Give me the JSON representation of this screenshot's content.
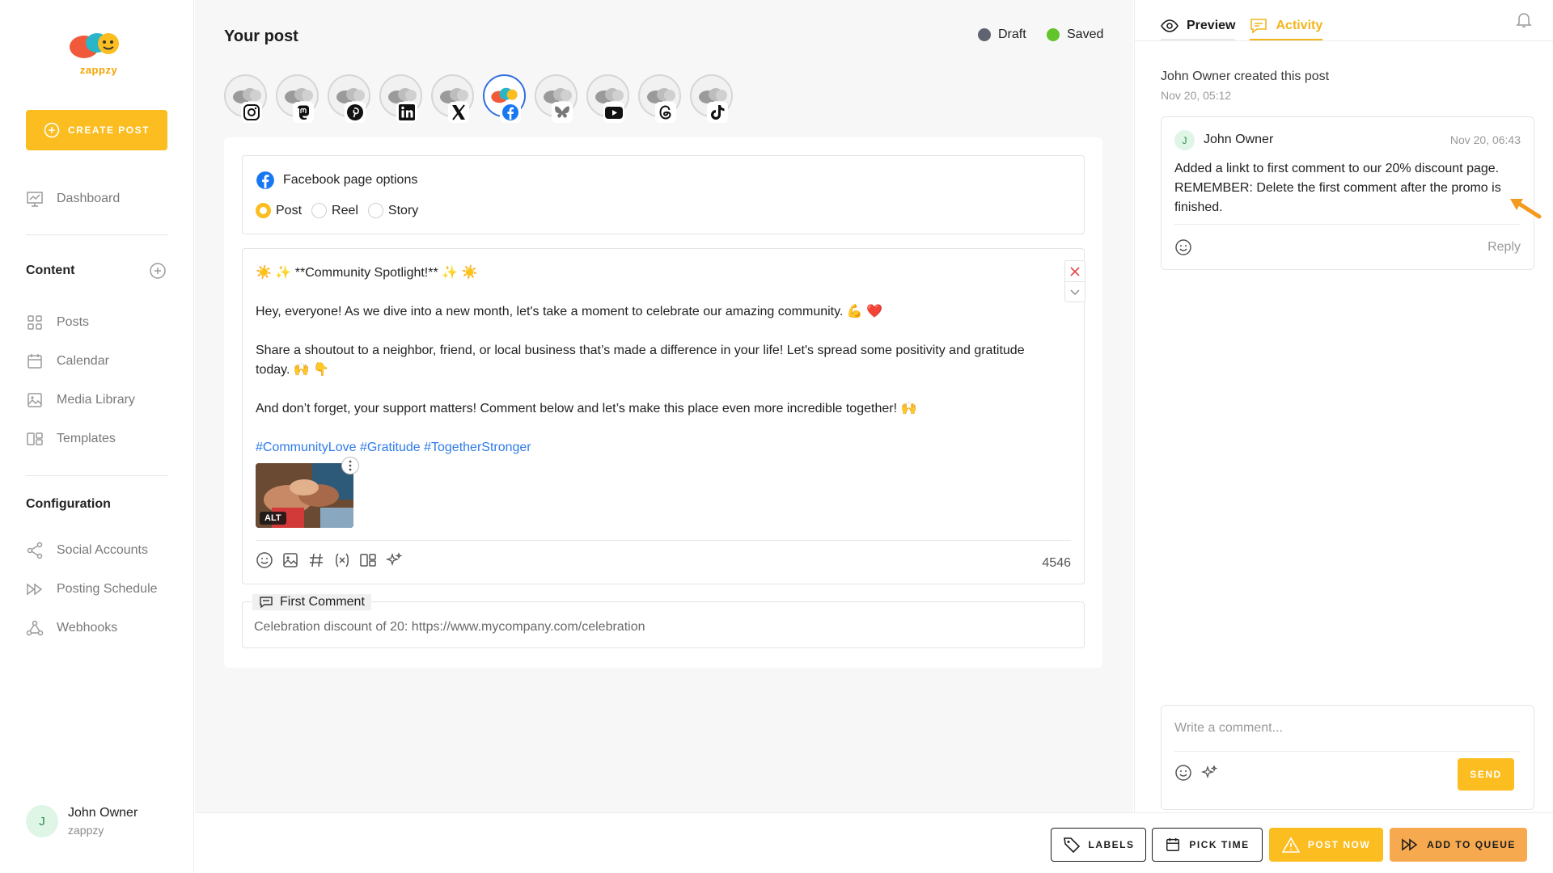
{
  "sidebar": {
    "logo_text": "zappzy",
    "create_post": "CREATE POST",
    "nav": {
      "dashboard": "Dashboard"
    },
    "content_section": {
      "title": "Content",
      "items": [
        "Posts",
        "Calendar",
        "Media Library",
        "Templates"
      ]
    },
    "config_section": {
      "title": "Configuration",
      "items": [
        "Social Accounts",
        "Posting Schedule",
        "Webhooks"
      ]
    },
    "user": {
      "initial": "J",
      "name": "John Owner",
      "workspace": "zappzy"
    }
  },
  "main": {
    "title": "Your post",
    "status": {
      "draft": "Draft",
      "saved": "Saved",
      "draft_color": "#5f6470",
      "saved_color": "#63c32a"
    },
    "accounts": [
      "instagram",
      "mastodon",
      "pinterest",
      "linkedin",
      "x",
      "facebook",
      "bluesky",
      "youtube",
      "threads",
      "tiktok"
    ],
    "active_account": "facebook",
    "facebook_options": {
      "title": "Facebook page options",
      "types": [
        "Post",
        "Reel",
        "Story"
      ],
      "selected": "Post"
    },
    "editor": {
      "line1": "☀️ ✨ **Community Spotlight!** ✨ ☀️",
      "line2": "Hey, everyone! As we dive into a new month, let's take a moment to celebrate our amazing community. 💪 ❤️",
      "line3": "Share a shoutout to a neighbor, friend, or local business that’s made a difference in your life! Let's spread some positivity and gratitude today. 🙌 👇",
      "line4": "And don’t forget, your support matters! Comment below and let’s make this place even more incredible together! 🙌",
      "hashtags": "#CommunityLove #Gratitude #TogetherStronger",
      "image_alt_badge": "ALT",
      "char_count": "4546"
    },
    "first_comment": {
      "label": "First Comment",
      "text": "Celebration discount of 20: https://www.mycompany.com/celebration"
    }
  },
  "right_panel": {
    "tabs": {
      "preview": "Preview",
      "activity": "Activity"
    },
    "activity": {
      "log": "John Owner created this post",
      "log_time": "Nov 20, 05:12"
    },
    "comment": {
      "initial": "J",
      "author": "John Owner",
      "date": "Nov 20, 06:43",
      "body": "Added a linkt to first comment to our 20% discount page. REMEMBER: Delete the first comment after the promo is finished.",
      "reply": "Reply"
    },
    "compose": {
      "placeholder": "Write a comment...",
      "send": "SEND"
    }
  },
  "bottom_bar": {
    "labels": "LABELS",
    "pick_time": "PICK TIME",
    "post_now": "POST NOW",
    "add_to_queue": "ADD TO QUEUE"
  },
  "colors": {
    "accent": "#fbbd1f",
    "queue": "#f7a94f",
    "link": "#2f7be8",
    "facebook": "#1877f2"
  }
}
